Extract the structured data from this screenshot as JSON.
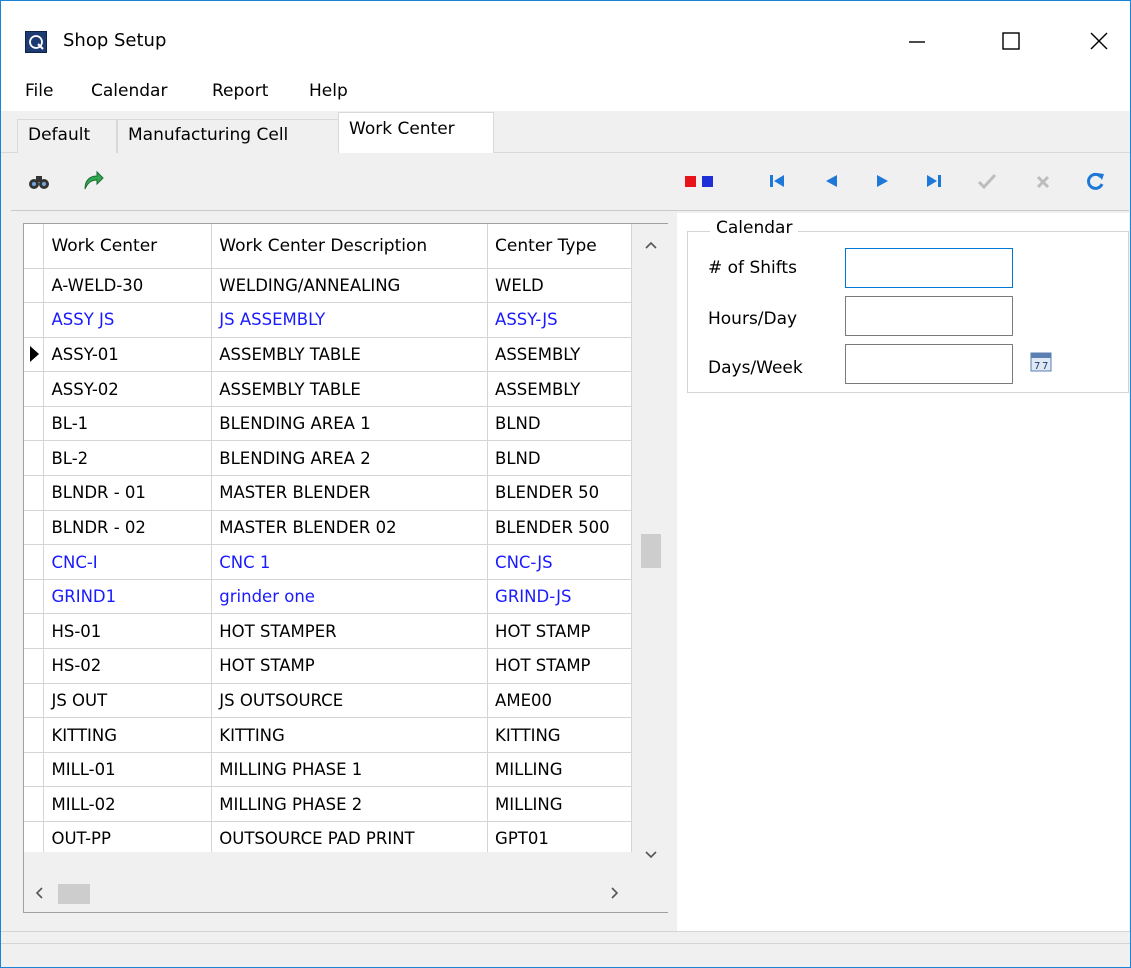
{
  "window": {
    "title": "Shop Setup"
  },
  "menu": [
    "File",
    "Calendar",
    "Report",
    "Help"
  ],
  "tabs": [
    {
      "label": "Default",
      "active": false
    },
    {
      "label": "Manufacturing Cell",
      "active": false
    },
    {
      "label": "Work Center",
      "active": true
    }
  ],
  "toolbar": {
    "left_icons": [
      "binoculars-icon",
      "green-arrow-icon"
    ],
    "right_icons": [
      "red-blue-squares-icon",
      "first-record-icon",
      "previous-record-icon",
      "next-record-icon",
      "last-record-icon",
      "confirm-icon",
      "cancel-icon",
      "refresh-icon"
    ]
  },
  "grid": {
    "columns": [
      "Work Center",
      "Work Center Description",
      "Center Type"
    ],
    "rows": [
      {
        "cells": [
          "A-WELD-30",
          "WELDING/ANNEALING",
          "WELD"
        ],
        "blue": false,
        "current": false
      },
      {
        "cells": [
          "ASSY JS",
          "JS ASSEMBLY",
          "ASSY-JS"
        ],
        "blue": true,
        "current": false
      },
      {
        "cells": [
          "ASSY-01",
          "ASSEMBLY TABLE",
          "ASSEMBLY"
        ],
        "blue": false,
        "current": true
      },
      {
        "cells": [
          "ASSY-02",
          "ASSEMBLY TABLE",
          "ASSEMBLY"
        ],
        "blue": false,
        "current": false
      },
      {
        "cells": [
          "BL-1",
          "BLENDING AREA 1",
          "BLND"
        ],
        "blue": false,
        "current": false
      },
      {
        "cells": [
          "BL-2",
          "BLENDING AREA 2",
          "BLND"
        ],
        "blue": false,
        "current": false
      },
      {
        "cells": [
          "BLNDR - 01",
          "MASTER BLENDER",
          "BLENDER 50"
        ],
        "blue": false,
        "current": false
      },
      {
        "cells": [
          "BLNDR - 02",
          "MASTER BLENDER 02",
          "BLENDER 500"
        ],
        "blue": false,
        "current": false
      },
      {
        "cells": [
          "CNC-I",
          "CNC 1",
          "CNC-JS"
        ],
        "blue": true,
        "current": false
      },
      {
        "cells": [
          "GRIND1",
          "grinder one",
          "GRIND-JS"
        ],
        "blue": true,
        "current": false
      },
      {
        "cells": [
          "HS-01",
          "HOT STAMPER",
          "HOT STAMP"
        ],
        "blue": false,
        "current": false
      },
      {
        "cells": [
          "HS-02",
          "HOT STAMP",
          "HOT STAMP"
        ],
        "blue": false,
        "current": false
      },
      {
        "cells": [
          "JS OUT",
          "JS OUTSOURCE",
          "AME00"
        ],
        "blue": false,
        "current": false
      },
      {
        "cells": [
          "KITTING",
          "KITTING",
          "KITTING"
        ],
        "blue": false,
        "current": false
      },
      {
        "cells": [
          "MILL-01",
          "MILLING PHASE 1",
          "MILLING"
        ],
        "blue": false,
        "current": false
      },
      {
        "cells": [
          "MILL-02",
          "MILLING PHASE 2",
          "MILLING"
        ],
        "blue": false,
        "current": false
      },
      {
        "cells": [
          "OUT-PP",
          "OUTSOURCE PAD PRINT",
          "GPT01"
        ],
        "blue": false,
        "current": false
      }
    ]
  },
  "calendar": {
    "group_label": "Calendar",
    "shifts_label": "# of Shifts",
    "shifts_value": "",
    "hours_label": "Hours/Day",
    "hours_value": "",
    "days_label": "Days/Week",
    "days_value": "",
    "calendar_icon": "calendar-icon"
  },
  "colors": {
    "accent": "#0078d7",
    "link_row": "#1a1aff",
    "nav_blue": "#1e78d8"
  }
}
